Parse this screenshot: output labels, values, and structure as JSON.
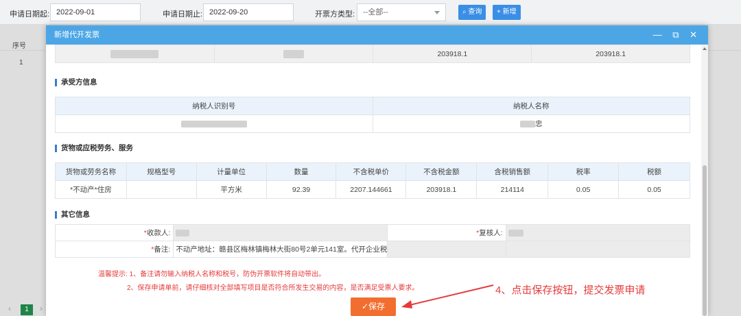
{
  "filter": {
    "start_label": "申请日期起:",
    "start_value": "2022-09-01",
    "end_label": "申请日期止:",
    "end_value": "2022-09-20",
    "type_label": "开票方类型:",
    "type_value": "--全部--",
    "query_label": "查询",
    "add_label": "+ 新增"
  },
  "grid": {
    "col_seq": "序号",
    "row_seq": "1"
  },
  "pager": {
    "prev": "‹",
    "page": "1",
    "next": "›"
  },
  "modal": {
    "title": "新增代开发票",
    "tools": "— ⧉ ✕",
    "top_row": {
      "amount1": "203918.1",
      "amount2": "203918.1"
    },
    "buyer": {
      "section": "承受方信息",
      "col_id": "纳税人识别号",
      "col_name": "纳税人名称",
      "name_tail": "忠"
    },
    "goods": {
      "section": "货物或应税劳务、服务",
      "headers": [
        "货物或劳务名称",
        "规格型号",
        "计量单位",
        "数量",
        "不含税单价",
        "不含税金额",
        "含税销售额",
        "税率",
        "税额"
      ],
      "row": [
        "*不动产*住房",
        "",
        "平方米",
        "92.39",
        "2207.144661",
        "203918.1",
        "214114",
        "0.05",
        "0.05"
      ]
    },
    "other": {
      "section": "其它信息",
      "payee_label": "收款人:",
      "reviewer_label": "复核人:",
      "remark_label": "备注:",
      "remark_value": "不动产地址：赣县区梅林镇梅林大街80号2单元141室。代开企业税",
      "required_mark": "*"
    },
    "tips": {
      "line1": "温馨提示: 1、备注请勿输入纳税人名称和税号，防伪开票软件将自动带出。",
      "line2": "2、保存申请单前，请仔细核对全部填写项目是否符合所发生交易的内容，是否满足受票人要求。"
    },
    "save_label": "✓保存"
  },
  "annotation": "4、点击保存按钮，提交发票申请",
  "colors": {
    "accent": "#4ca6e6",
    "save": "#f26e2f",
    "tip": "#e53b3b"
  }
}
